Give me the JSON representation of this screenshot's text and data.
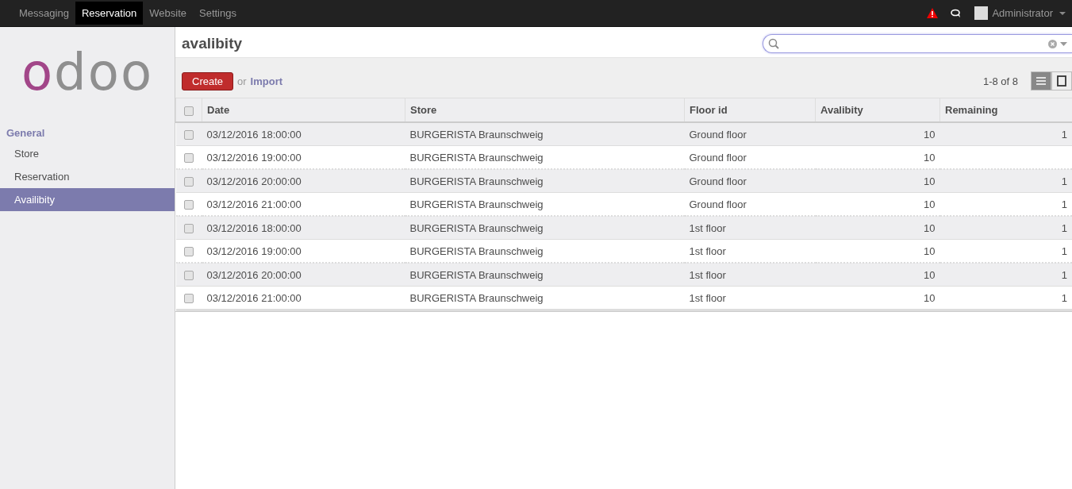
{
  "top_menu": [
    {
      "label": "Messaging",
      "selected": false
    },
    {
      "label": "Reservation",
      "selected": true
    },
    {
      "label": "Website",
      "selected": false
    },
    {
      "label": "Settings",
      "selected": false
    }
  ],
  "user": {
    "name": "Administrator"
  },
  "sidebar": {
    "logo": "odoo",
    "section": "General",
    "items": [
      {
        "label": "Store",
        "selected": false
      },
      {
        "label": "Reservation",
        "selected": false
      },
      {
        "label": "Availibity",
        "selected": true
      }
    ]
  },
  "page_title": "avalibity",
  "search": {
    "focused": true
  },
  "toolbar": {
    "create": "Create",
    "or": "or",
    "import": "Import",
    "pager": "1-8 of 8",
    "views": [
      {
        "kind": "list",
        "selected": true
      },
      {
        "kind": "kanban",
        "selected": false
      }
    ]
  },
  "table": {
    "all_checked": false,
    "columns": [
      "Date",
      "Store",
      "Floor id",
      "Avalibity",
      "Remaining"
    ],
    "rows": [
      {
        "checked": false,
        "cells": [
          "03/12/2016 18:00:00",
          "BURGERISTA Braunschweig",
          "Ground floor",
          "10",
          "1"
        ]
      },
      {
        "checked": false,
        "cells": [
          "03/12/2016 19:00:00",
          "BURGERISTA Braunschweig",
          "Ground floor",
          "10",
          null
        ]
      },
      {
        "checked": false,
        "cells": [
          "03/12/2016 20:00:00",
          "BURGERISTA Braunschweig",
          "Ground floor",
          "10",
          "1"
        ]
      },
      {
        "checked": false,
        "cells": [
          "03/12/2016 21:00:00",
          "BURGERISTA Braunschweig",
          "Ground floor",
          "10",
          "1"
        ]
      },
      {
        "checked": false,
        "cells": [
          "03/12/2016 18:00:00",
          "BURGERISTA Braunschweig",
          "1st floor",
          "10",
          "1"
        ]
      },
      {
        "checked": false,
        "cells": [
          "03/12/2016 19:00:00",
          "BURGERISTA Braunschweig",
          "1st floor",
          "10",
          "1"
        ]
      },
      {
        "checked": false,
        "cells": [
          "03/12/2016 20:00:00",
          "BURGERISTA Braunschweig",
          "1st floor",
          "10",
          "1"
        ]
      },
      {
        "checked": false,
        "cells": [
          "03/12/2016 21:00:00",
          "BURGERISTA Braunschweig",
          "1st floor",
          "10",
          "1"
        ]
      }
    ]
  }
}
